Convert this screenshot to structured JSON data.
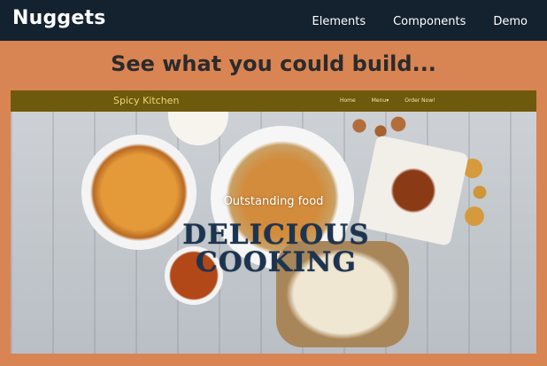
{
  "site": {
    "brand": "Nuggets",
    "nav": [
      "Elements",
      "Components",
      "Demo"
    ]
  },
  "headline": "See what you could build...",
  "preview": {
    "brand": "Spicy Kitchen",
    "links": [
      "Home",
      "Menu▾",
      "Order Now!"
    ],
    "tagline": "Outstanding food",
    "hero_line1": "DELICIOUS",
    "hero_line2": "COOKING"
  },
  "colors": {
    "page_bg": "#d98453",
    "topnav_bg": "#14222f",
    "preview_nav_bg": "#6e5a0c",
    "hero_text": "#1d3450"
  }
}
